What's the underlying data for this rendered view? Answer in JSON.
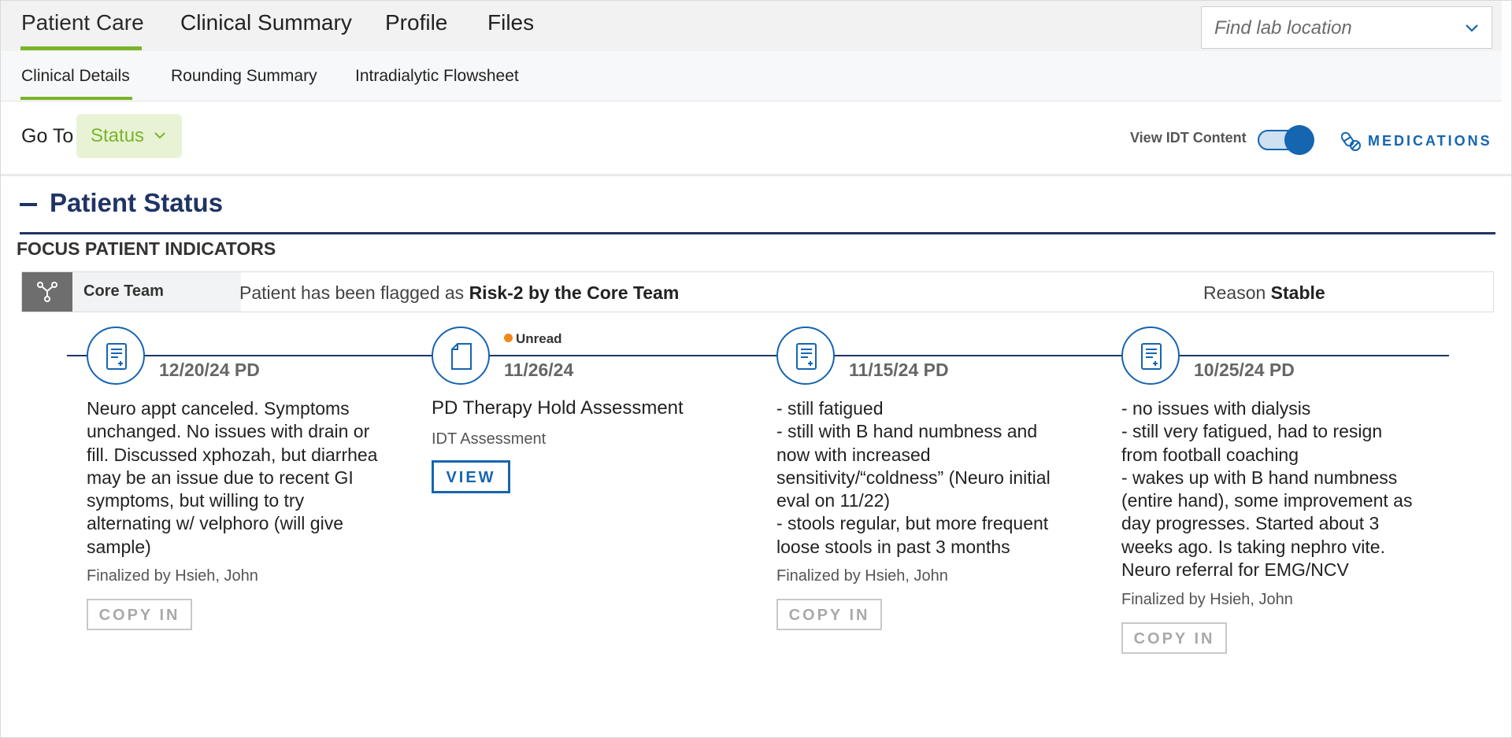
{
  "top_tabs": [
    {
      "label": "Patient Care",
      "active": true
    },
    {
      "label": "Clinical Summary",
      "active": false
    },
    {
      "label": "Profile",
      "active": false
    },
    {
      "label": "Files",
      "active": false
    }
  ],
  "lab_location": {
    "placeholder": "Find lab location",
    "value": ""
  },
  "sub_tabs": [
    {
      "label": "Clinical Details",
      "active": true
    },
    {
      "label": "Rounding Summary",
      "active": false
    },
    {
      "label": "Intradialytic Flowsheet",
      "active": false
    }
  ],
  "goto": {
    "label": "Go To",
    "selected": "Status"
  },
  "idt_toggle": {
    "label": "View IDT Content",
    "on": true
  },
  "medications_link": {
    "label": "MEDICATIONS"
  },
  "section": {
    "title": "Patient Status",
    "subtitle": "FOCUS PATIENT INDICATORS"
  },
  "indicator": {
    "team": "Core Team",
    "flag_prefix": "Patient has been flagged as ",
    "flag_value": "Risk-2 by the Core Team",
    "reason_label": "Reason ",
    "reason_value": "Stable"
  },
  "timeline": [
    {
      "date": "12/20/24 PD",
      "body": "Neuro appt canceled. Symptoms\nunchanged. No issues with drain or\nfill. Discussed xphozah, but diarrhea\nmay be an issue due to recent GI\nsymptoms, but willing to try\nalternating w/ velphoro (will give\nsample)",
      "finalized": "Finalized by Hsieh, John",
      "button": "COPY IN"
    },
    {
      "date": "11/26/24",
      "unread": "Unread",
      "title": "PD Therapy Hold Assessment",
      "subtitle": "IDT Assessment",
      "button": "VIEW"
    },
    {
      "date": "11/15/24 PD",
      "body": "- still fatigued\n- still with B hand numbness and\nnow with increased\nsensitivity/“coldness” (Neuro initial\neval on 11/22)\n- stools regular, but more frequent\nloose stools in past 3 months",
      "finalized": "Finalized by Hsieh, John",
      "button": "COPY IN"
    },
    {
      "date": "10/25/24 PD",
      "body": "- no issues with dialysis\n- still very fatigued, had to resign\nfrom football coaching\n- wakes up with B hand numbness\n(entire hand), some improvement as\nday progresses. Started about 3\nweeks ago. Is taking nephro vite.\nNeuro referral for EMG/NCV",
      "finalized": "Finalized by Hsieh, John",
      "button": "COPY IN"
    }
  ]
}
